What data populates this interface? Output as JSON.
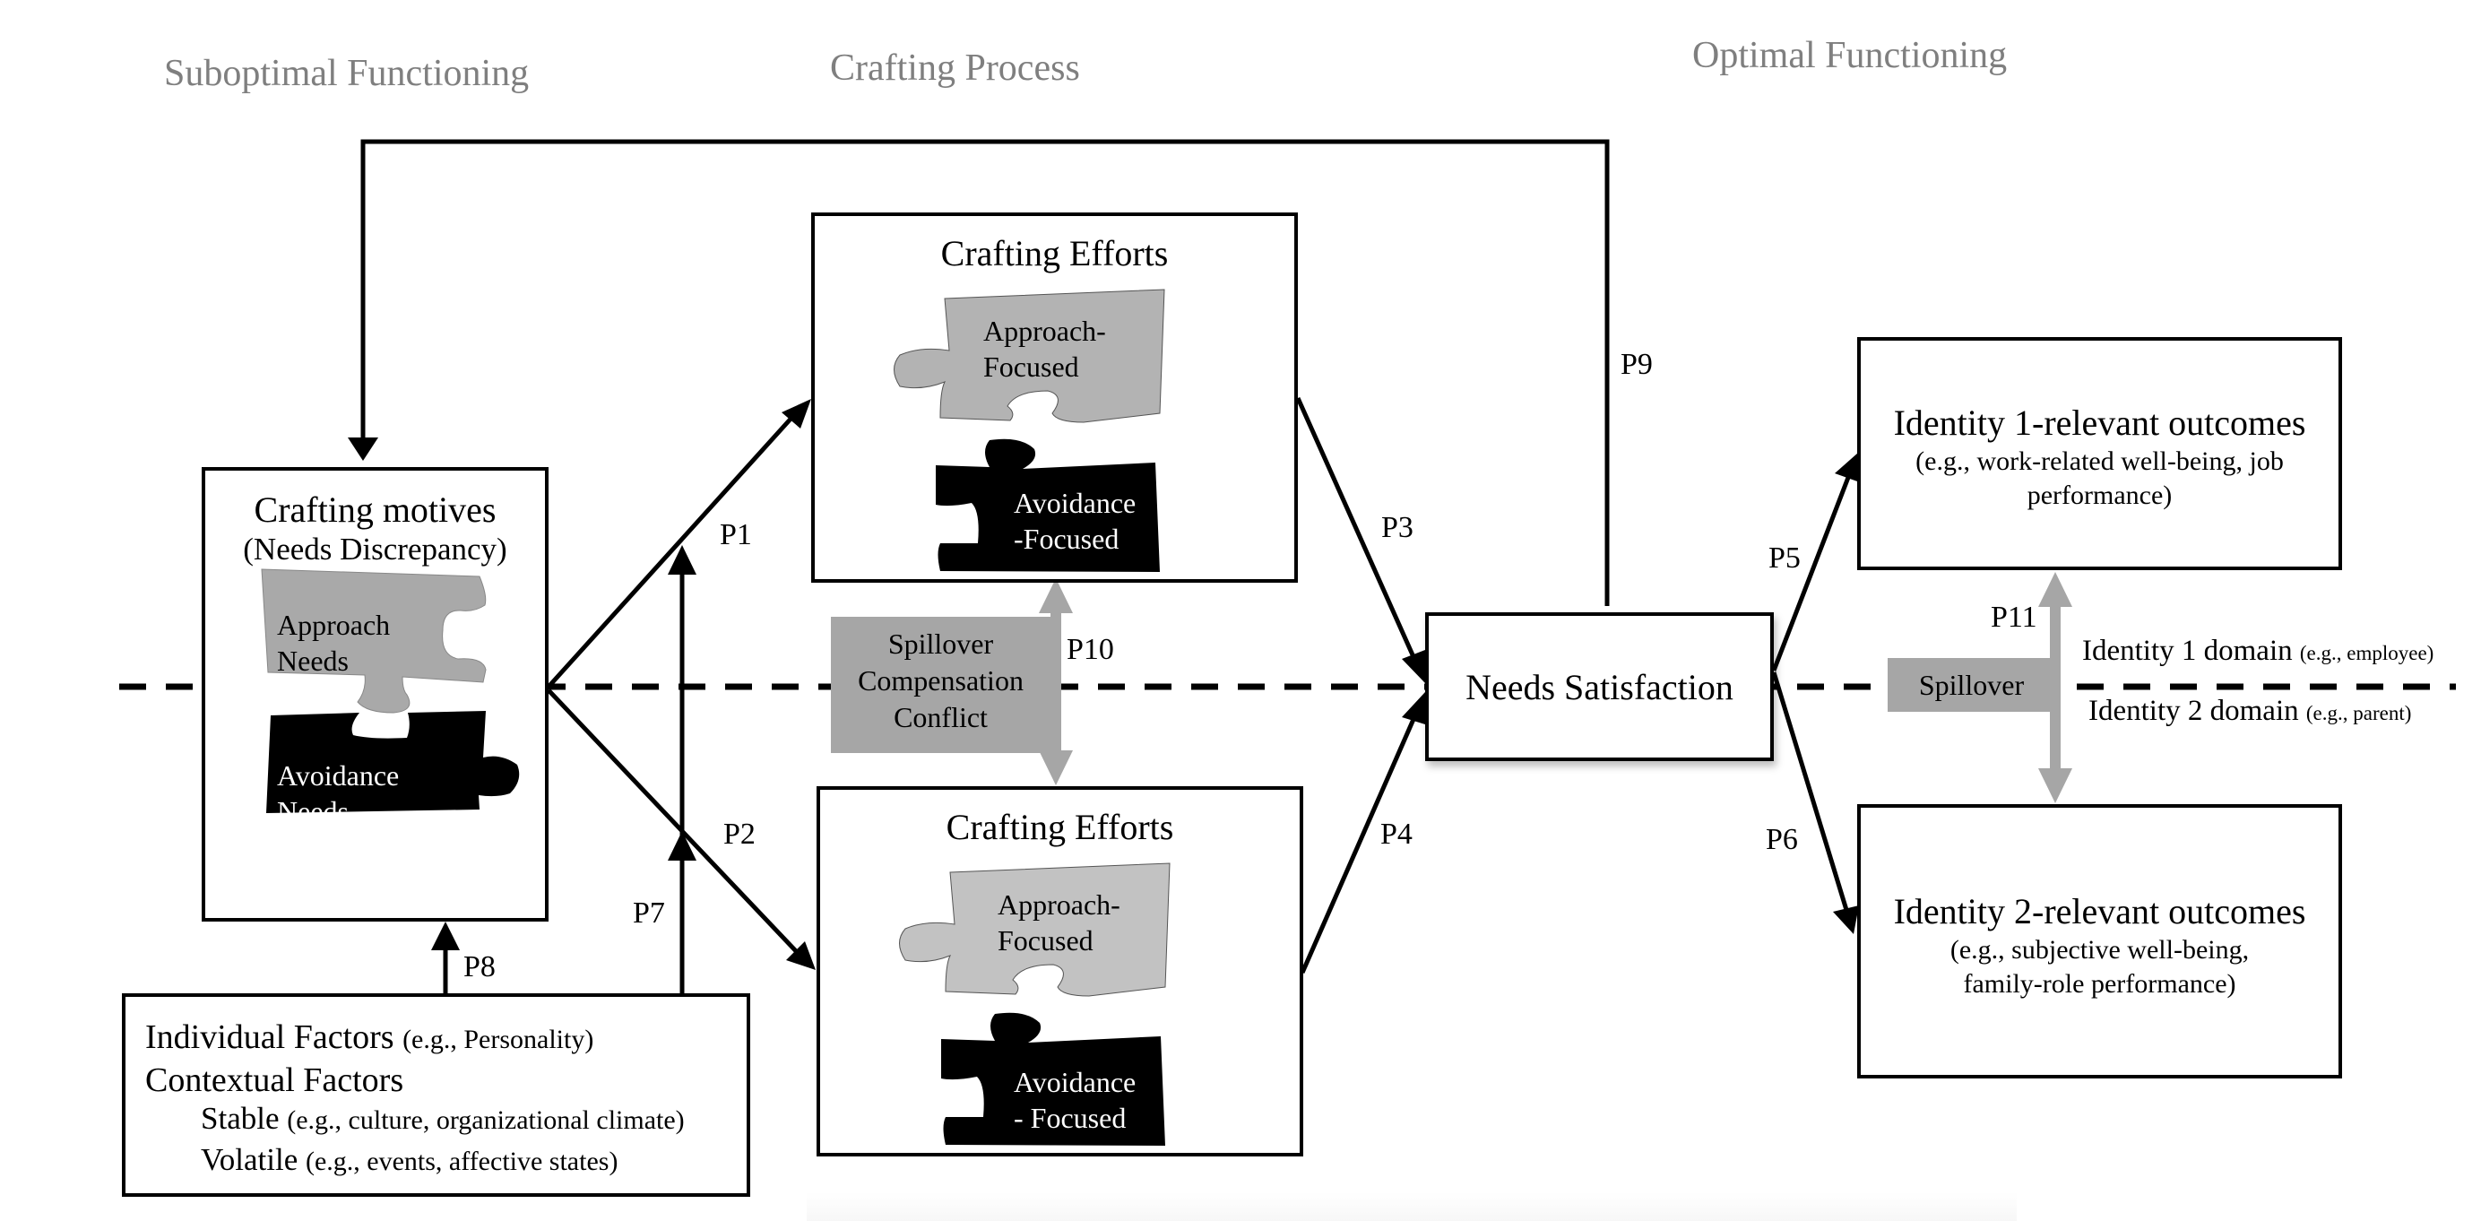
{
  "sections": {
    "suboptimal": "Suboptimal Functioning",
    "process": "Crafting Process",
    "optimal": "Optimal Functioning"
  },
  "crafting_motives": {
    "title": "Crafting motives",
    "subtitle": "(Needs Discrepancy)",
    "approach": [
      "Approach",
      "Needs"
    ],
    "avoidance": [
      "Avoidance",
      "Needs"
    ]
  },
  "crafting_efforts_top": {
    "title": "Crafting Efforts",
    "approach": [
      "Approach-",
      "Focused"
    ],
    "avoidance": [
      "Avoidance",
      "-Focused"
    ]
  },
  "crafting_efforts_bottom": {
    "title": "Crafting Efforts",
    "approach": [
      "Approach-",
      "Focused"
    ],
    "avoidance": [
      "Avoidance",
      "- Focused"
    ]
  },
  "spillover_center": [
    "Spillover",
    "Compensation",
    "Conflict"
  ],
  "needs_satisfaction": "Needs Satisfaction",
  "identity1_outcomes": {
    "title": "Identity 1-relevant outcomes",
    "detail": [
      "(e.g., work-related well-being, job",
      "performance)"
    ]
  },
  "identity2_outcomes": {
    "title": "Identity 2-relevant outcomes",
    "detail": [
      "(e.g., subjective well-being,",
      "family-role performance)"
    ]
  },
  "spillover_right": "Spillover",
  "domains": {
    "identity1": {
      "name": "Identity 1 domain",
      "example": "(e.g., employee)"
    },
    "identity2": {
      "name": "Identity 2 domain",
      "example": "(e.g., parent)"
    }
  },
  "factors": {
    "individual": {
      "name": "Individual Factors",
      "example": "(e.g., Personality)"
    },
    "contextual": {
      "name": "Contextual Factors"
    },
    "stable": {
      "name": "Stable",
      "example": "(e.g., culture, organizational climate)"
    },
    "volatile": {
      "name": "Volatile",
      "example": "(e.g., events, affective states)"
    }
  },
  "paths": {
    "p1": "P1",
    "p2": "P2",
    "p3": "P3",
    "p4": "P4",
    "p5": "P5",
    "p6": "P6",
    "p7": "P7",
    "p8": "P8",
    "p9": "P9",
    "p10": "P10",
    "p11": "P11"
  },
  "colors": {
    "section_title": "#7f7f7f",
    "spillover_gray": "#a6a6a6",
    "approach_piece_dark": "#a9a9a9",
    "approach_piece_top": "#b3b3b3",
    "approach_piece_bottom": "#c2c2c2",
    "avoidance_piece": "#000000"
  }
}
